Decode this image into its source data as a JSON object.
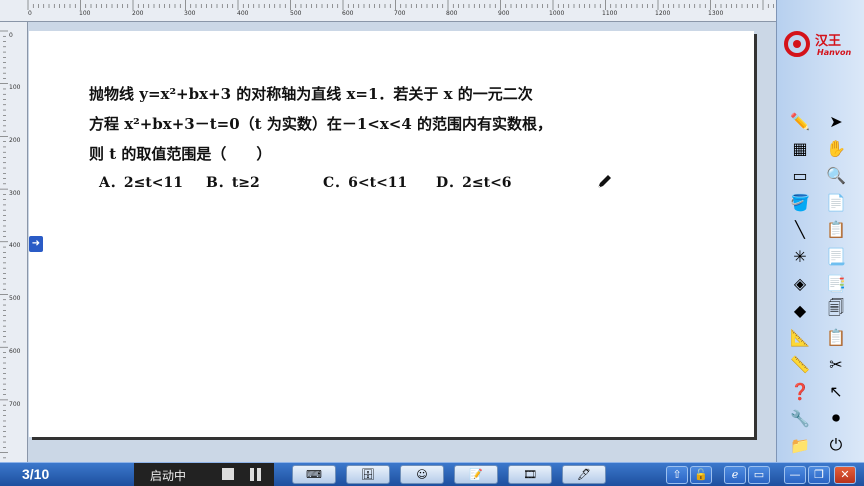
{
  "ruler": {
    "top_labels": [
      "0",
      "100",
      "200",
      "300",
      "400",
      "500",
      "600",
      "700",
      "800",
      "900",
      "1000",
      "1100",
      "1200",
      "1300"
    ],
    "left_labels": [
      "0",
      "100",
      "200",
      "300",
      "400",
      "500",
      "600",
      "700"
    ]
  },
  "question": {
    "line1": "抛物线 y=x²+bx+3 的对称轴为直线 x=1．若关于 x 的一元二次",
    "line2": "方程 x²+bx+3－t=0（t 为实数）在－1<x<4 的范围内有实数根，",
    "line3": "则 t 的取值范围是（　　）",
    "options": {
      "a": "A．2≤t<11",
      "b": "B．t≥2",
      "c": "C．6<t<11",
      "d": "D．2≤t<6"
    }
  },
  "logo": {
    "text": "汉王",
    "subtext": "Hanvon"
  },
  "taskbar": {
    "page_count": "3/10",
    "status": "启动中"
  },
  "colors": {
    "taskbar": "#1d4f9e",
    "panel": "#dbe8f8",
    "logo_red": "#d4121a"
  },
  "icons": [
    "pen-icon",
    "arrow-cursor-icon",
    "eraser-pattern-icon",
    "hand-icon",
    "eraser-icon",
    "magnifier-icon",
    "paint-bucket-icon",
    "new-page-icon",
    "line-icon",
    "delete-page-icon",
    "axes-icon",
    "page-prev-icon",
    "shapes-icon",
    "page-next-icon",
    "3d-shapes-icon",
    "copy-page-icon",
    "compass-icon",
    "paste-icon",
    "ruler-icon",
    "scissors-icon",
    "help-icon",
    "pointer-icon",
    "wrench-icon",
    "record-icon",
    "folder-icon",
    "exit-icon"
  ]
}
